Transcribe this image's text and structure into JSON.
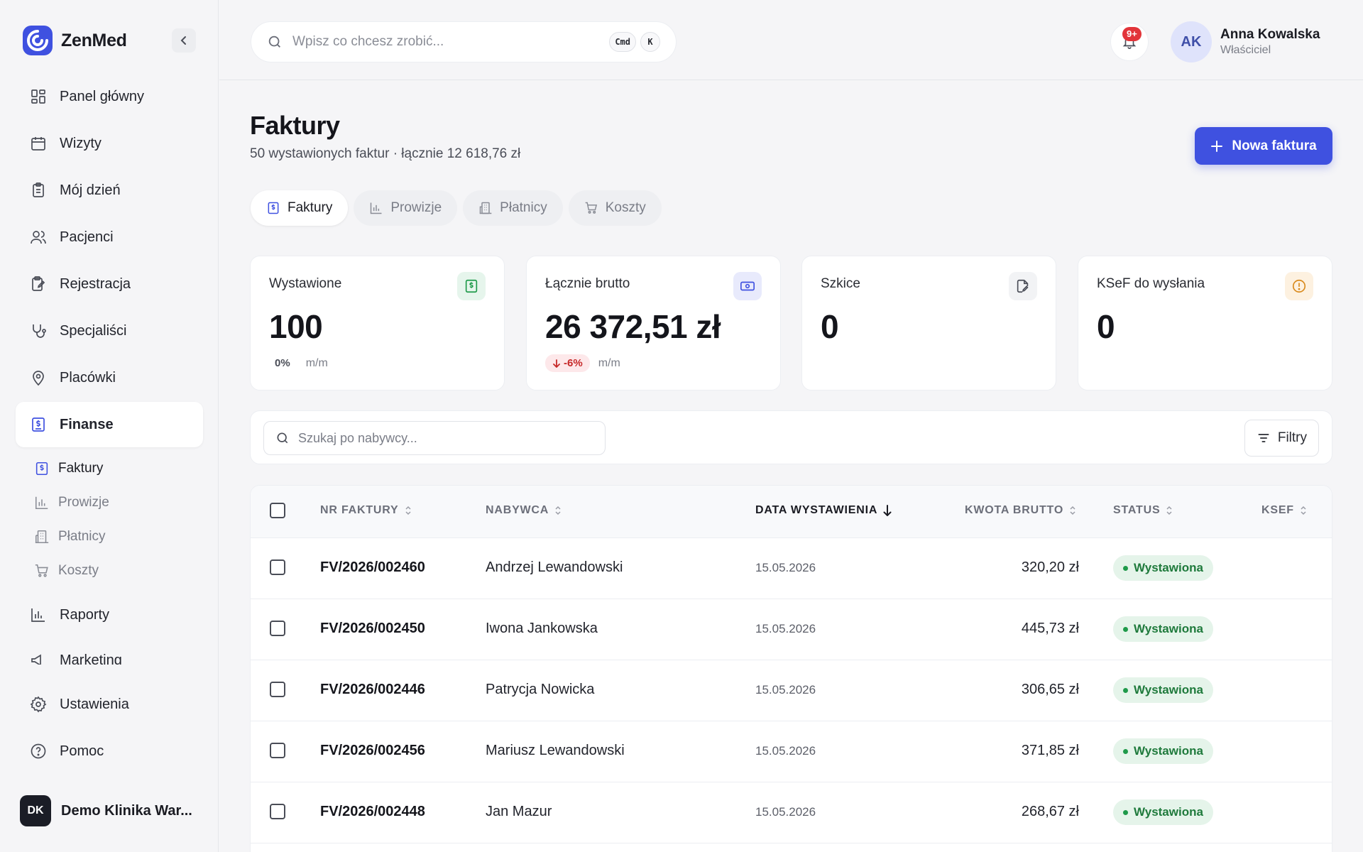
{
  "app": {
    "name": "ZenMed"
  },
  "sidebar": {
    "items": [
      {
        "label": "Panel główny",
        "icon": "dashboard-icon"
      },
      {
        "label": "Wizyty",
        "icon": "calendar-icon"
      },
      {
        "label": "Mój dzień",
        "icon": "clipboard-icon"
      },
      {
        "label": "Pacjenci",
        "icon": "users-icon"
      },
      {
        "label": "Rejestracja",
        "icon": "clipboard-edit-icon"
      },
      {
        "label": "Specjaliści",
        "icon": "stethoscope-icon"
      },
      {
        "label": "Placówki",
        "icon": "map-pin-icon"
      },
      {
        "label": "Finanse",
        "icon": "invoice-icon"
      }
    ],
    "subitems": [
      {
        "label": "Faktury",
        "icon": "invoice-icon"
      },
      {
        "label": "Prowizje",
        "icon": "bar-chart-icon"
      },
      {
        "label": "Płatnicy",
        "icon": "building-icon"
      },
      {
        "label": "Koszty",
        "icon": "cart-icon"
      }
    ],
    "lower_items": [
      {
        "label": "Raporty",
        "icon": "bar-chart-icon"
      },
      {
        "label": "Marketing",
        "icon": "megaphone-icon"
      }
    ],
    "footer_items": [
      {
        "label": "Ustawienia",
        "icon": "gear-icon"
      },
      {
        "label": "Pomoc",
        "icon": "help-icon"
      }
    ],
    "clinic": {
      "initials": "DK",
      "name": "Demo Klinika War..."
    }
  },
  "header": {
    "search_placeholder": "Wpisz co chcesz zrobić...",
    "shortcut_keys": [
      "Cmd",
      "K"
    ],
    "notifications_badge": "9+",
    "user": {
      "initials": "AK",
      "name": "Anna Kowalska",
      "role": "Właściciel"
    }
  },
  "page": {
    "title": "Faktury",
    "subtitle": "50 wystawionych faktur · łącznie 12 618,76 zł",
    "new_button": "Nowa faktura",
    "tabs": [
      {
        "label": "Faktury",
        "active": true
      },
      {
        "label": "Prowizje",
        "active": false
      },
      {
        "label": "Płatnicy",
        "active": false
      },
      {
        "label": "Koszty",
        "active": false
      }
    ]
  },
  "stats": [
    {
      "label": "Wystawione",
      "value": "100",
      "trend": "0%",
      "period": "m/m",
      "icon": "invoice-icon",
      "accent": "#1f9a4a"
    },
    {
      "label": "Łącznie brutto",
      "value": "26 372,51 zł",
      "trend": "-6%",
      "period": "m/m",
      "icon": "cash-icon",
      "accent": "#3f51e0"
    },
    {
      "label": "Szkice",
      "value": "0",
      "icon": "file-edit-icon",
      "accent": "#4a4d57"
    },
    {
      "label": "KSeF do wysłania",
      "value": "0",
      "icon": "alert-circle-icon",
      "accent": "#d98a1c"
    }
  ],
  "filters": {
    "search_placeholder": "Szukaj po nabywcy...",
    "button_label": "Filtry"
  },
  "table": {
    "columns": [
      "NR FAKTURY",
      "NABYWCA",
      "DATA WYSTAWIENIA",
      "KWOTA BRUTTO",
      "STATUS",
      "KSEF"
    ],
    "rows": [
      {
        "nr": "FV/2026/002460",
        "buyer": "Andrzej Lewandowski",
        "date": "15.05.2026",
        "amount": "320,20 zł",
        "status": "Wystawiona"
      },
      {
        "nr": "FV/2026/002450",
        "buyer": "Iwona Jankowska",
        "date": "15.05.2026",
        "amount": "445,73 zł",
        "status": "Wystawiona"
      },
      {
        "nr": "FV/2026/002446",
        "buyer": "Patrycja Nowicka",
        "date": "15.05.2026",
        "amount": "306,65 zł",
        "status": "Wystawiona"
      },
      {
        "nr": "FV/2026/002456",
        "buyer": "Mariusz Lewandowski",
        "date": "15.05.2026",
        "amount": "371,85 zł",
        "status": "Wystawiona"
      },
      {
        "nr": "FV/2026/002448",
        "buyer": "Jan Mazur",
        "date": "15.05.2026",
        "amount": "268,67 zł",
        "status": "Wystawiona"
      }
    ]
  },
  "colors": {
    "accent": "#3f51e0",
    "success": "#1f9a4a",
    "danger": "#c62828",
    "warning": "#d98a1c"
  }
}
